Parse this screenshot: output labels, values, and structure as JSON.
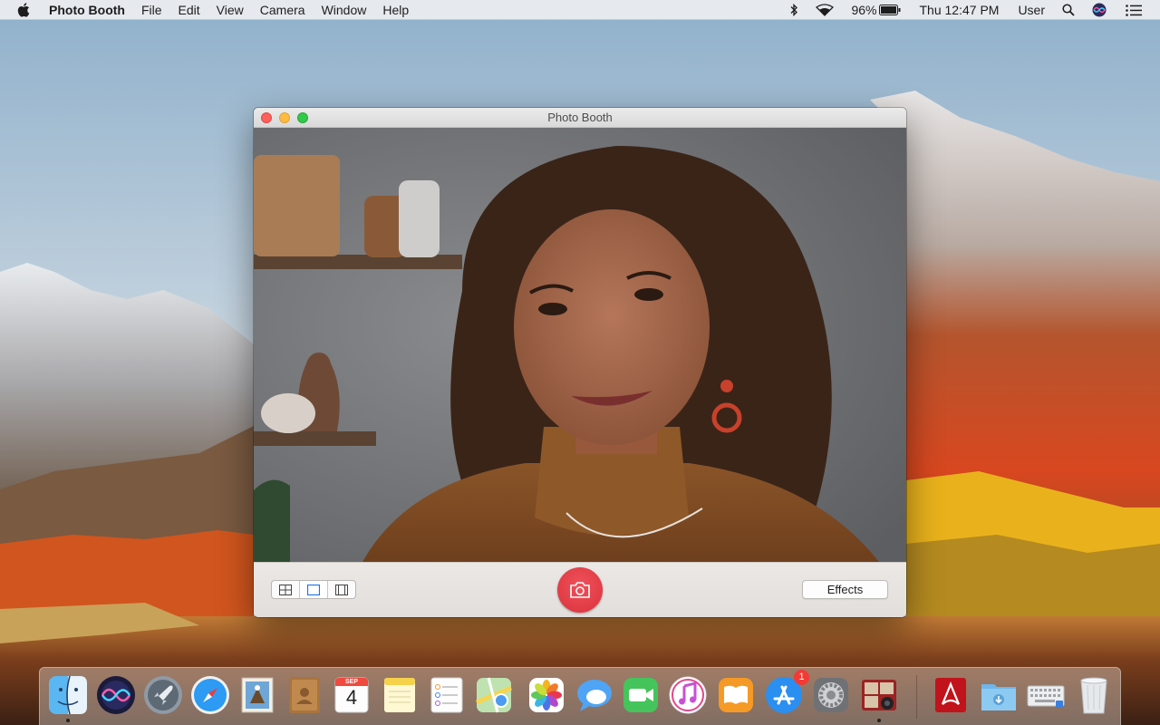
{
  "menubar": {
    "app_name": "Photo Booth",
    "menus": [
      "File",
      "Edit",
      "View",
      "Camera",
      "Window",
      "Help"
    ],
    "battery": "96%",
    "clock": "Thu 12:47 PM",
    "user": "User",
    "status_icons": [
      "bluetooth-icon",
      "wifi-icon",
      "battery-icon",
      "spotlight-search-icon",
      "siri-icon",
      "notification-center-icon"
    ]
  },
  "window": {
    "title": "Photo Booth",
    "view_modes": [
      "four-up-grid",
      "single-photo",
      "filmstrip"
    ],
    "selected_view_mode": "single-photo",
    "effects_label": "Effects"
  },
  "calendar_icon": {
    "month": "SEP",
    "day": "4"
  },
  "dock": {
    "items": [
      "Finder",
      "Siri",
      "Launchpad",
      "Safari",
      "Mail",
      "Contacts",
      "Calendar",
      "Notes",
      "Reminders",
      "Maps",
      "Photos",
      "Messages",
      "FaceTime",
      "iTunes",
      "iBooks",
      "App Store",
      "System Preferences",
      "Photo Booth",
      "Adobe Acrobat Reader",
      "Downloads",
      "Keyboard Viewer",
      "Trash"
    ],
    "running": [
      "Finder",
      "Photo Booth"
    ],
    "app_store_badge": "1"
  },
  "colors": {
    "shutter": "#e4353f",
    "close": "#fc605c",
    "minimize": "#fdbc40",
    "zoom": "#34c84a"
  }
}
